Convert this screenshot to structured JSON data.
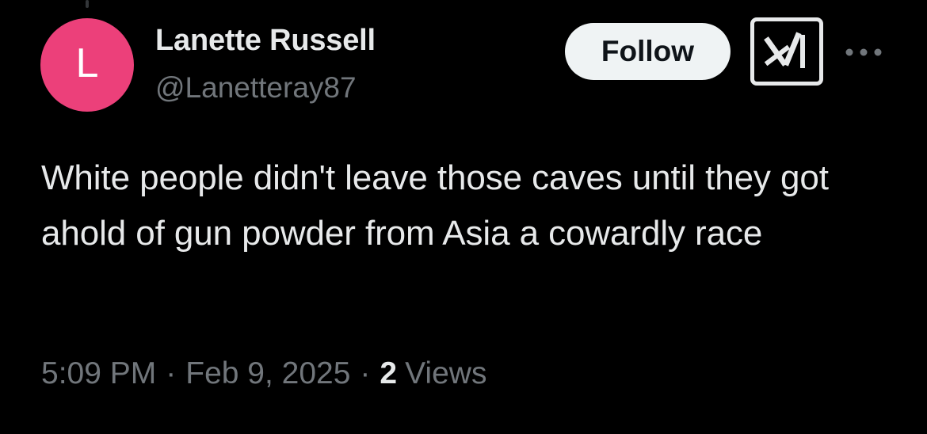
{
  "author": {
    "avatar_letter": "L",
    "avatar_color": "#ec407a",
    "display_name": "Lanette Russell",
    "handle": "@Lanetteray87"
  },
  "actions": {
    "follow_label": "Follow",
    "grok_icon": "grok-icon",
    "more_icon": "more-horizontal-icon"
  },
  "tweet": {
    "text": "White people didn't leave those caves until they got ahold of gun powder from Asia a cowardly race"
  },
  "meta": {
    "time": "5:09 PM",
    "date": "Feb 9, 2025",
    "separator": "·",
    "views_count": "2",
    "views_label": "Views"
  },
  "colors": {
    "background": "#000000",
    "primary_text": "#e7e9ea",
    "secondary_text": "#71767b",
    "follow_bg": "#eff3f4"
  }
}
